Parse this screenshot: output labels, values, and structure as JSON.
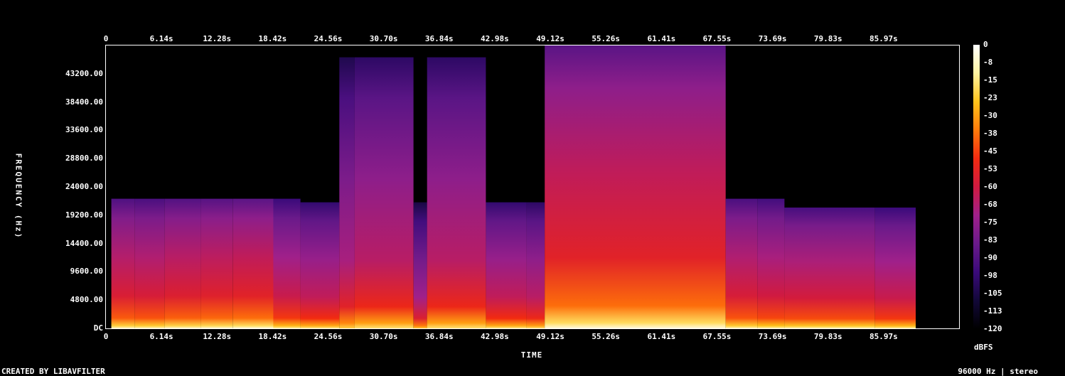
{
  "chart_data": {
    "type": "heatmap",
    "title": "",
    "xlabel": "TIME",
    "ylabel": "FREQUENCY (Hz)",
    "colorbar_label": "dBFS",
    "x_ticks": [
      "0",
      "6.14s",
      "12.28s",
      "18.42s",
      "24.56s",
      "30.70s",
      "36.84s",
      "42.98s",
      "49.12s",
      "55.26s",
      "61.41s",
      "67.55s",
      "73.69s",
      "79.83s",
      "85.97s"
    ],
    "y_ticks": [
      "DC",
      "4800.00",
      "9600.00",
      "14400.00",
      "19200.00",
      "24000.00",
      "28800.00",
      "33600.00",
      "38400.00",
      "43200.00"
    ],
    "colorbar_ticks": [
      "0",
      "-8",
      "-15",
      "-23",
      "-30",
      "-38",
      "-45",
      "-53",
      "-60",
      "-68",
      "-75",
      "-83",
      "-90",
      "-98",
      "-105",
      "-113",
      "-120"
    ],
    "xlim": [
      0,
      94.3
    ],
    "ylim": [
      0,
      48000
    ],
    "zlim": [
      -120,
      0
    ],
    "colormap": [
      "#000000",
      "#120838",
      "#3a0a7a",
      "#6a1a8a",
      "#a0208a",
      "#d01a40",
      "#f22a10",
      "#ff7a0a",
      "#ffc21a",
      "#fff3a0",
      "#ffffff"
    ],
    "segments": [
      {
        "t": [
          0.6,
          3.2
        ],
        "cutoff": 22000,
        "level": -65
      },
      {
        "t": [
          3.2,
          6.5
        ],
        "cutoff": 22000,
        "level": -66
      },
      {
        "t": [
          6.5,
          10.5
        ],
        "cutoff": 22000,
        "level": -64
      },
      {
        "t": [
          10.5,
          14.0
        ],
        "cutoff": 22000,
        "level": -63
      },
      {
        "t": [
          14.0,
          18.5
        ],
        "cutoff": 22000,
        "level": -62
      },
      {
        "t": [
          18.5,
          21.5
        ],
        "cutoff": 22000,
        "level": -70
      },
      {
        "t": [
          21.5,
          25.8
        ],
        "cutoff": 21400,
        "level": -72
      },
      {
        "t": [
          25.8,
          27.5
        ],
        "cutoff": 46000,
        "level": -78
      },
      {
        "t": [
          27.5,
          34.0
        ],
        "cutoff": 46000,
        "level": -74
      },
      {
        "t": [
          34.0,
          35.5
        ],
        "cutoff": 21400,
        "level": -80
      },
      {
        "t": [
          35.5,
          42.0
        ],
        "cutoff": 46000,
        "level": -74
      },
      {
        "t": [
          42.0,
          46.5
        ],
        "cutoff": 21400,
        "level": -72
      },
      {
        "t": [
          46.5,
          48.5
        ],
        "cutoff": 21400,
        "level": -74
      },
      {
        "t": [
          48.5,
          68.5
        ],
        "cutoff": 48000,
        "level": -62
      },
      {
        "t": [
          68.5,
          72.0
        ],
        "cutoff": 22000,
        "level": -66
      },
      {
        "t": [
          72.0,
          75.0
        ],
        "cutoff": 22000,
        "level": -68
      },
      {
        "t": [
          75.0,
          85.0
        ],
        "cutoff": 20500,
        "level": -67
      },
      {
        "t": [
          85.0,
          89.5
        ],
        "cutoff": 20500,
        "level": -70
      }
    ]
  },
  "footer": {
    "credit": "CREATED BY LIBAVFILTER",
    "format": "96000 Hz | stereo"
  }
}
